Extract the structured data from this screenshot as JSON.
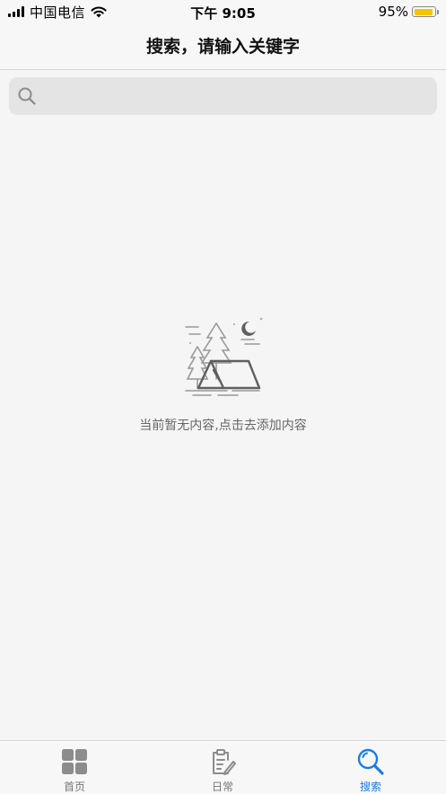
{
  "status_bar": {
    "carrier": "中国电信",
    "time": "下午 9:05",
    "battery_percent": "95%",
    "battery_level": 0.95,
    "battery_color": "#f4c400"
  },
  "nav": {
    "title": "搜索，请输入关键字"
  },
  "search": {
    "placeholder": "",
    "value": "",
    "icon": "search-icon"
  },
  "empty_state": {
    "illustration": "camping-tent-icon",
    "message": "当前暂无内容,点击去添加内容"
  },
  "tabs": [
    {
      "label": "首页",
      "icon": "grid-icon",
      "active": false
    },
    {
      "label": "日常",
      "icon": "clipboard-icon",
      "active": false
    },
    {
      "label": "搜索",
      "icon": "search-icon",
      "active": true
    }
  ],
  "colors": {
    "accent": "#1a7be6",
    "inactive": "#777777",
    "background": "#f5f5f5"
  }
}
